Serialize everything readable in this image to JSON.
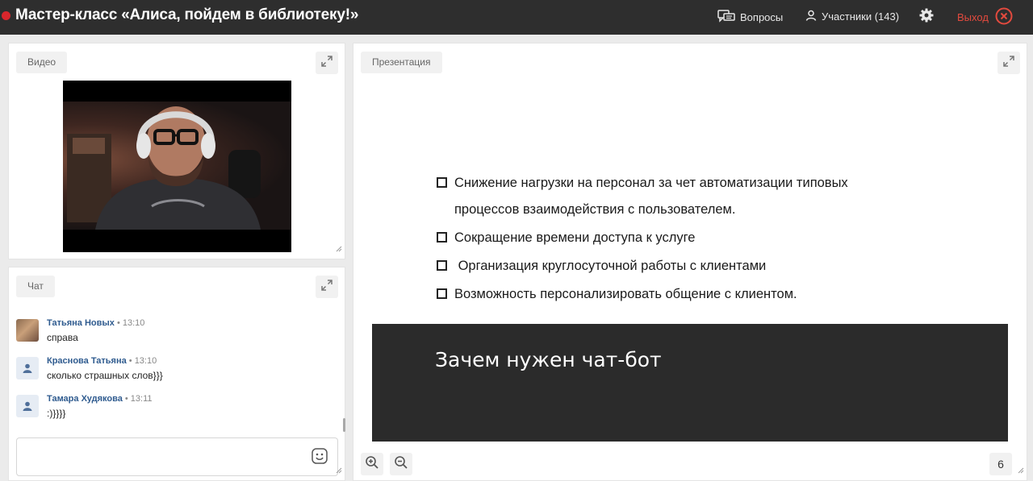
{
  "header": {
    "title": "Мастер-класс «Алиса, пойдем в библиотеку!»",
    "questions_label": "Вопросы",
    "participants_label": "Участники (143)",
    "exit_label": "Выход"
  },
  "video_panel": {
    "label": "Видео"
  },
  "chat_panel": {
    "label": "Чат",
    "messages": [
      {
        "name": "Татьяна Новых",
        "time": "• 13:10",
        "text": "справа"
      },
      {
        "name": "Краснова Татьяна",
        "time": "• 13:10",
        "text": "сколько страшных слов}}}"
      },
      {
        "name": "Тамара Худякова",
        "time": "• 13:11",
        "text": ":)}}}}"
      }
    ],
    "input_placeholder": ""
  },
  "presentation_panel": {
    "label": "Презентация",
    "bullets": [
      "Снижение нагрузки на персонал за чет автоматизации типовых",
      "процессов взаимодействия с пользователем.",
      "Сокращение времени доступа к услуге",
      " Организация круглосуточной работы с клиентами",
      "Возможность персонализировать общение с клиентом."
    ],
    "slide_title": "Зачем нужен чат-бот",
    "page_number": "6"
  },
  "colors": {
    "topbar": "#2e2e2e",
    "record_dot": "#d9262c",
    "exit": "#e34a3e",
    "chat_name": "#2f5b8f",
    "slide_dark": "#2b2b2b"
  },
  "icons": [
    "record-dot-icon",
    "questions-icon",
    "user-icon",
    "gear-icon",
    "close-circle-icon",
    "expand-icon",
    "resize-grip-icon",
    "user-avatar-icon",
    "smile-icon",
    "zoom-in-icon",
    "zoom-out-icon"
  ]
}
